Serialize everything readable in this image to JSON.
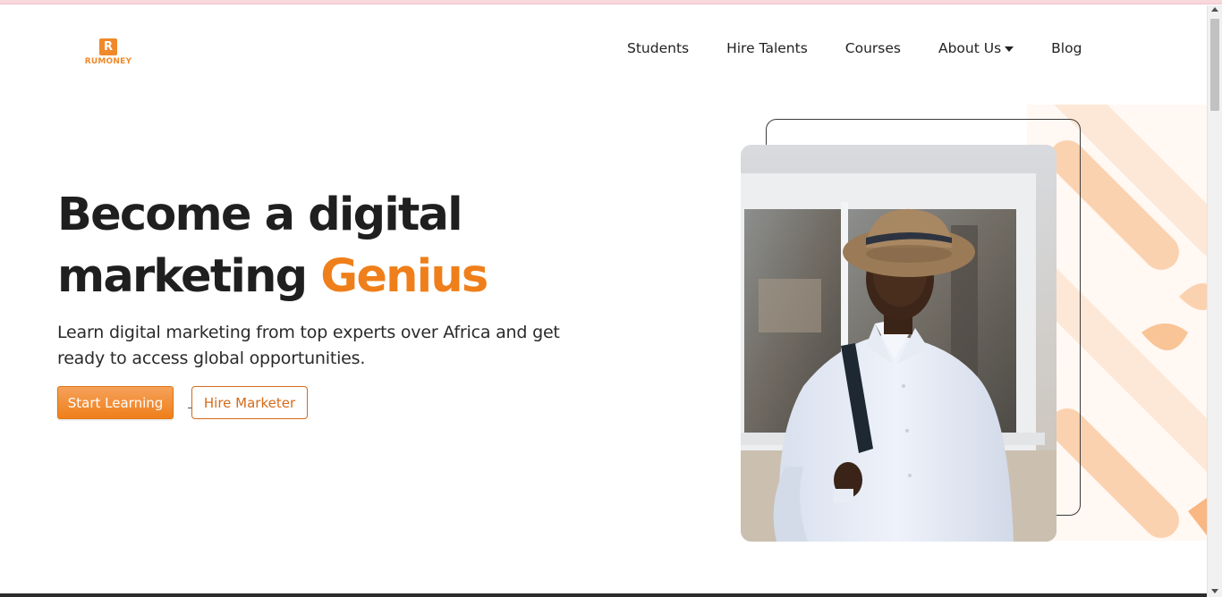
{
  "brand": {
    "logo_letter": "R",
    "name": "RUMONEY",
    "color": "#f0892a"
  },
  "nav": {
    "items": [
      {
        "label": "Students"
      },
      {
        "label": "Hire Talents"
      },
      {
        "label": "Courses"
      },
      {
        "label": "About Us",
        "icon": "caret-down-icon"
      },
      {
        "label": "Blog"
      }
    ]
  },
  "hero": {
    "title_line1": "Become a digital",
    "title_line2_prefix": "marketing ",
    "title_accent": "Genius",
    "accent_color": "#ef7f1a",
    "subtitle": "Learn digital marketing from top experts over Africa and get ready to access global opportunities.",
    "primary_button": "Start Learning",
    "secondary_button": "Hire Marketer",
    "image_alt": "Young man in a white shirt and straw hat carrying a backpack"
  },
  "colors": {
    "accent": "#ef7f1a",
    "pattern": "#fbd2b0",
    "text": "#1f1f1f"
  }
}
